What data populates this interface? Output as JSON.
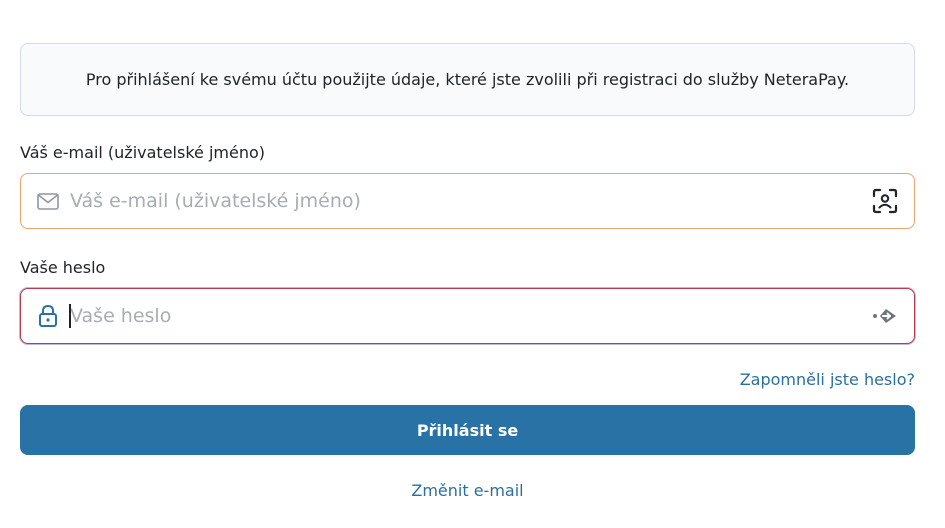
{
  "info": {
    "text": "Pro přihlášení ke svému účtu použijte údaje, které jste zvolili při registraci do služby NeteraPay."
  },
  "email": {
    "label": "Váš e-mail (uživatelské jméno)",
    "placeholder": "Váš e-mail (uživatelské jméno)",
    "value": "",
    "lead_icon": "envelope-icon",
    "trail_icon": "face-id-icon",
    "border_color": "#f0a36d"
  },
  "password": {
    "label": "Vaše heslo",
    "placeholder": "Vaše heslo",
    "value": "",
    "lead_icon": "lock-icon",
    "trail_icon": "autofill-arrow-icon",
    "border_color": "#b93a4f"
  },
  "forgot": {
    "label": "Zapomněli jste heslo?"
  },
  "submit": {
    "label": "Přihlásit se",
    "background": "#2872a6"
  },
  "change_email": {
    "label": "Změnit e-mail"
  },
  "colors": {
    "link": "#2a6f9f",
    "info_bg": "#f8fafc"
  }
}
